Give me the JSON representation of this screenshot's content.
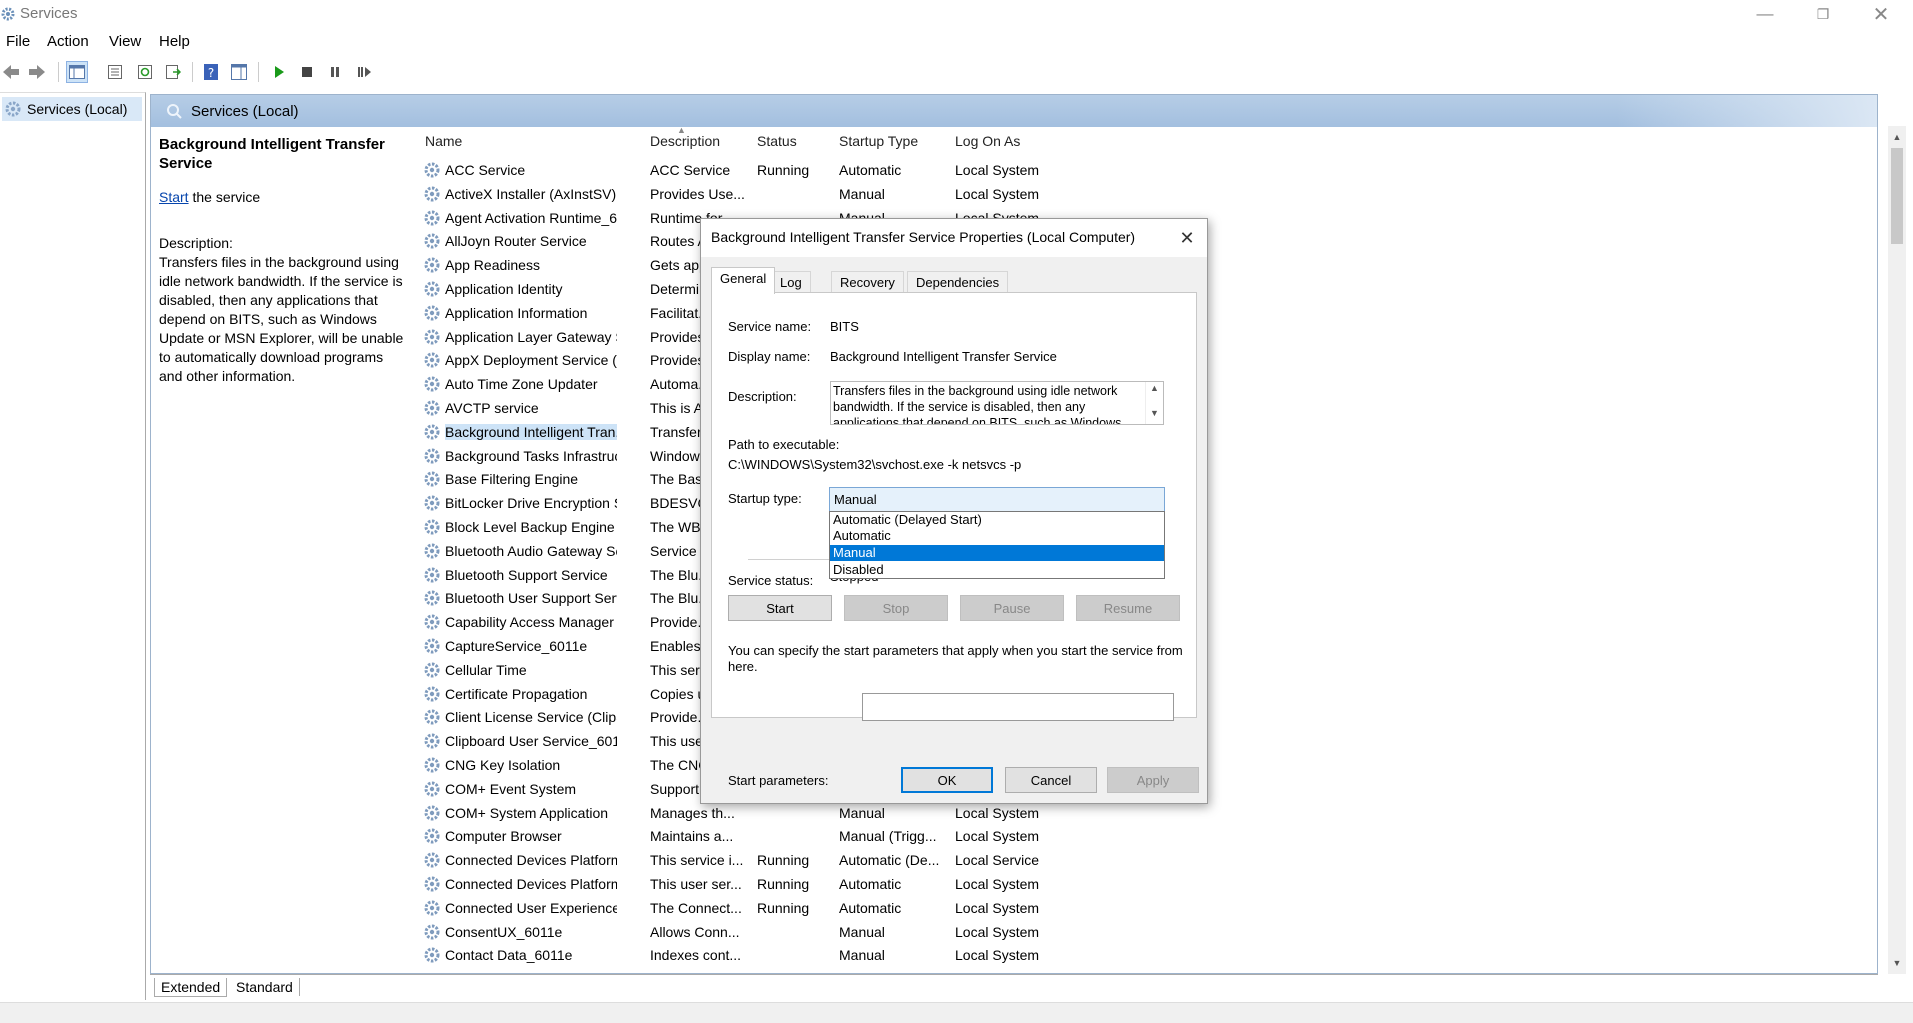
{
  "window": {
    "title": "Services"
  },
  "menu": [
    "File",
    "Action",
    "View",
    "Help"
  ],
  "tree": {
    "root": "Services (Local)"
  },
  "pane": {
    "header": "Services (Local)"
  },
  "extended": {
    "service_name": "Background Intelligent Transfer Service",
    "start_link": "Start",
    "start_suffix": " the service",
    "description_label": "Description:",
    "description": "Transfers files in the background using idle network bandwidth. If the service is disabled, then any applications that depend on BITS, such as Windows Update or MSN Explorer, will be unable to automatically download programs and other information."
  },
  "columns": [
    "Name",
    "Description",
    "Status",
    "Startup Type",
    "Log On As"
  ],
  "rows": [
    {
      "name": "ACC Service",
      "desc": "ACC Service",
      "status": "Running",
      "startup": "Automatic",
      "logon": "Local System"
    },
    {
      "name": "ActiveX Installer (AxInstSV)",
      "desc": "Provides Use...",
      "status": "",
      "startup": "Manual",
      "logon": "Local System"
    },
    {
      "name": "Agent Activation Runtime_6...",
      "desc": "Runtime for...",
      "status": "",
      "startup": "Manual",
      "logon": "Local System"
    },
    {
      "name": "AllJoyn Router Service",
      "desc": "Routes Al...",
      "status": "",
      "startup": "",
      "logon": ""
    },
    {
      "name": "App Readiness",
      "desc": "Gets app...",
      "status": "",
      "startup": "",
      "logon": ""
    },
    {
      "name": "Application Identity",
      "desc": "Determi...",
      "status": "",
      "startup": "",
      "logon": ""
    },
    {
      "name": "Application Information",
      "desc": "Facilitat...",
      "status": "",
      "startup": "",
      "logon": ""
    },
    {
      "name": "Application Layer Gateway S...",
      "desc": "Provides...",
      "status": "",
      "startup": "",
      "logon": ""
    },
    {
      "name": "AppX Deployment Service (A...",
      "desc": "Provides...",
      "status": "",
      "startup": "",
      "logon": ""
    },
    {
      "name": "Auto Time Zone Updater",
      "desc": "Automa...",
      "status": "",
      "startup": "",
      "logon": ""
    },
    {
      "name": "AVCTP service",
      "desc": "This is A...",
      "status": "",
      "startup": "",
      "logon": ""
    },
    {
      "name": "Background Intelligent Tran...",
      "desc": "Transfer...",
      "status": "",
      "startup": "",
      "logon": ""
    },
    {
      "name": "Background Tasks Infrastruc...",
      "desc": "Window...",
      "status": "",
      "startup": "",
      "logon": ""
    },
    {
      "name": "Base Filtering Engine",
      "desc": "The Bas...",
      "status": "",
      "startup": "",
      "logon": ""
    },
    {
      "name": "BitLocker Drive Encryption S...",
      "desc": "BDESVC...",
      "status": "",
      "startup": "",
      "logon": ""
    },
    {
      "name": "Block Level Backup Engine S...",
      "desc": "The WB...",
      "status": "",
      "startup": "",
      "logon": ""
    },
    {
      "name": "Bluetooth Audio Gateway Se...",
      "desc": "Service s...",
      "status": "",
      "startup": "",
      "logon": ""
    },
    {
      "name": "Bluetooth Support Service",
      "desc": "The Blu...",
      "status": "",
      "startup": "",
      "logon": ""
    },
    {
      "name": "Bluetooth User Support Serv...",
      "desc": "The Blu...",
      "status": "",
      "startup": "",
      "logon": ""
    },
    {
      "name": "Capability Access Manager S...",
      "desc": "Provide...",
      "status": "",
      "startup": "",
      "logon": ""
    },
    {
      "name": "CaptureService_6011e",
      "desc": "Enables...",
      "status": "",
      "startup": "",
      "logon": ""
    },
    {
      "name": "Cellular Time",
      "desc": "This ser...",
      "status": "",
      "startup": "",
      "logon": ""
    },
    {
      "name": "Certificate Propagation",
      "desc": "Copies u...",
      "status": "",
      "startup": "",
      "logon": ""
    },
    {
      "name": "Client License Service (ClipSV...",
      "desc": "Provide...",
      "status": "",
      "startup": "",
      "logon": ""
    },
    {
      "name": "Clipboard User Service_6011e",
      "desc": "This use...",
      "status": "",
      "startup": "",
      "logon": ""
    },
    {
      "name": "CNG Key Isolation",
      "desc": "The CNG...",
      "status": "",
      "startup": "",
      "logon": ""
    },
    {
      "name": "COM+ Event System",
      "desc": "Support...",
      "status": "",
      "startup": "",
      "logon": ""
    },
    {
      "name": "COM+ System Application",
      "desc": "Manages th...",
      "status": "",
      "startup": "Manual",
      "logon": "Local System"
    },
    {
      "name": "Computer Browser",
      "desc": "Maintains a...",
      "status": "",
      "startup": "Manual (Trigg...",
      "logon": "Local System"
    },
    {
      "name": "Connected Devices Platform ...",
      "desc": "This service i...",
      "status": "Running",
      "startup": "Automatic (De...",
      "logon": "Local Service"
    },
    {
      "name": "Connected Devices Platform ...",
      "desc": "This user ser...",
      "status": "Running",
      "startup": "Automatic",
      "logon": "Local System"
    },
    {
      "name": "Connected User Experiences ...",
      "desc": "The Connect...",
      "status": "Running",
      "startup": "Automatic",
      "logon": "Local System"
    },
    {
      "name": "ConsentUX_6011e",
      "desc": "Allows Conn...",
      "status": "",
      "startup": "Manual",
      "logon": "Local System"
    },
    {
      "name": "Contact Data_6011e",
      "desc": "Indexes cont...",
      "status": "",
      "startup": "Manual",
      "logon": "Local System"
    }
  ],
  "bottom_tabs": [
    "Extended",
    "Standard"
  ],
  "dialog": {
    "title": "Background Intelligent Transfer Service Properties (Local Computer)",
    "tabs": [
      "General",
      "Log On",
      "Recovery",
      "Dependencies"
    ],
    "service_name_label": "Service name:",
    "service_name": "BITS",
    "display_name_label": "Display name:",
    "display_name": "Background Intelligent Transfer Service",
    "description_label": "Description:",
    "description": "Transfers files in the background using idle network bandwidth. If the service is disabled, then any applications that depend on BITS, such as Windows",
    "path_label": "Path to executable:",
    "path": "C:\\WINDOWS\\System32\\svchost.exe -k netsvcs -p",
    "startup_label": "Startup type:",
    "startup_value": "Manual",
    "startup_options": [
      "Automatic (Delayed Start)",
      "Automatic",
      "Manual",
      "Disabled"
    ],
    "status_label": "Service status:",
    "status_value": "Stopped",
    "buttons": {
      "start": "Start",
      "stop": "Stop",
      "pause": "Pause",
      "resume": "Resume"
    },
    "hint": "You can specify the start parameters that apply when you start the service from here.",
    "params_label": "Start parameters:",
    "ok": "OK",
    "cancel": "Cancel",
    "apply": "Apply"
  }
}
